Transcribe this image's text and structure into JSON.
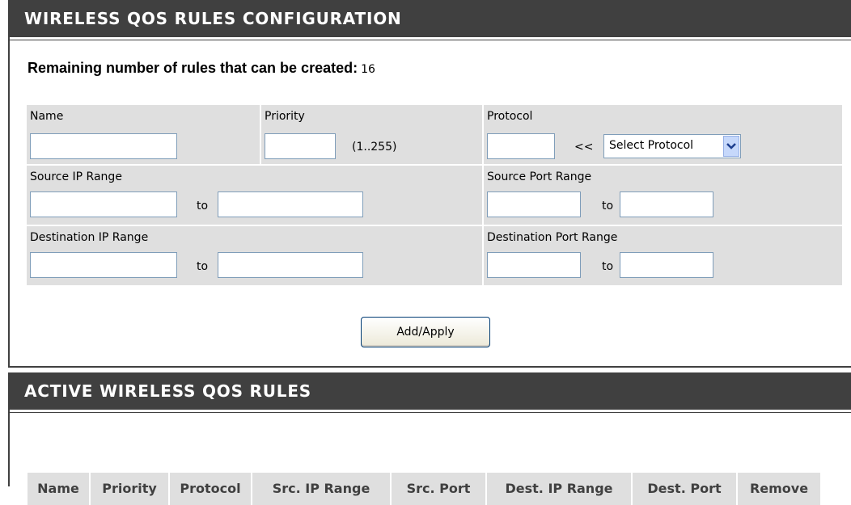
{
  "config_section": {
    "title": "WIRELESS QOS RULES CONFIGURATION",
    "remaining_label": "Remaining number of rules that can be created:",
    "remaining_value": "16",
    "fields": {
      "name_label": "Name",
      "priority_label": "Priority",
      "priority_hint": "(1..255)",
      "protocol_label": "Protocol",
      "protocol_arrow": "<<",
      "protocol_select_value": "Select Protocol",
      "src_ip_label": "Source IP Range",
      "src_port_label": "Source Port Range",
      "dst_ip_label": "Destination IP Range",
      "dst_port_label": "Destination Port Range",
      "to_label": "to"
    },
    "add_button_label": "Add/Apply"
  },
  "active_section": {
    "title": "ACTIVE WIRELESS QOS RULES",
    "columns": [
      "Name",
      "Priority",
      "Protocol",
      "Src. IP Range",
      "Src. Port",
      "Dest. IP Range",
      "Dest. Port",
      "Remove"
    ]
  }
}
